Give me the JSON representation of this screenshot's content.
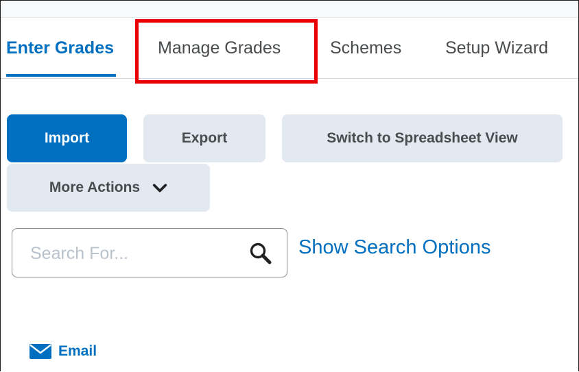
{
  "tabs": [
    {
      "label": "Enter Grades",
      "active": true
    },
    {
      "label": "Manage Grades",
      "active": false,
      "highlighted": true
    },
    {
      "label": "Schemes",
      "active": false
    },
    {
      "label": "Setup Wizard",
      "active": false
    }
  ],
  "toolbar": {
    "import_label": "Import",
    "export_label": "Export",
    "spreadsheet_label": "Switch to Spreadsheet View",
    "more_actions_label": "More Actions"
  },
  "search": {
    "placeholder": "Search For...",
    "value": "",
    "options_link": "Show Search Options"
  },
  "actions": {
    "email_label": "Email"
  },
  "colors": {
    "accent": "#006fbf",
    "secondary_button": "#e3e9f1",
    "highlight": "#ea0000",
    "text": "#494c4e"
  },
  "icons": {
    "chevron": "chevron-down-icon",
    "search": "search-icon",
    "email": "envelope-icon"
  }
}
